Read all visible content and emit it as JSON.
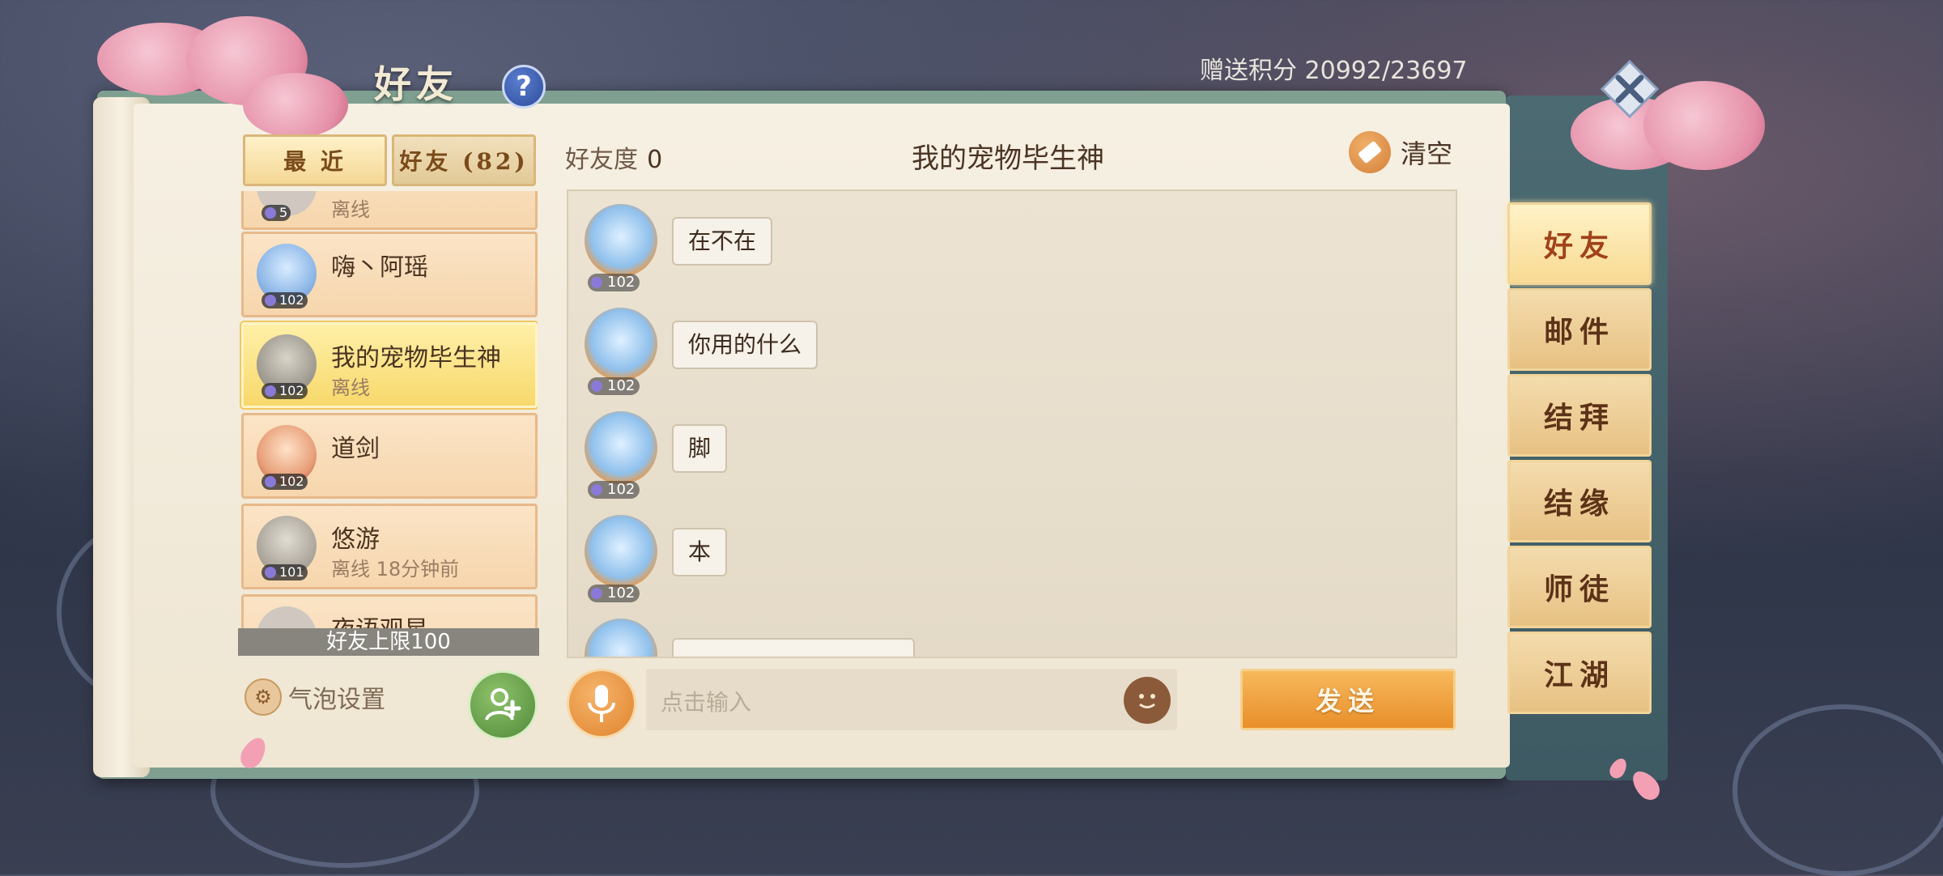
{
  "header": {
    "title": "好友",
    "help_label": "?",
    "points_label": "赠送积分 20992/23697"
  },
  "left_tabs": [
    {
      "label": "最 近",
      "active": true
    },
    {
      "label": "好友 (82)",
      "active": false
    }
  ],
  "friends": [
    {
      "name": "",
      "status": "离线",
      "level": "5"
    },
    {
      "name": "嗨丶阿瑶",
      "status": "",
      "level": "102"
    },
    {
      "name": "我的宠物毕生神",
      "status": "离线",
      "level": "102",
      "selected": true
    },
    {
      "name": "道剑",
      "status": "",
      "level": "102"
    },
    {
      "name": "悠游",
      "status": "离线 18分钟前",
      "level": "101"
    },
    {
      "name": "夜语观星",
      "status": "",
      "level": ""
    }
  ],
  "friend_limit": "好友上限100",
  "bubble_settings_label": "气泡设置",
  "chat": {
    "friendship_label": "好友度",
    "friendship_value": "0",
    "title": "我的宠物毕生神",
    "clear_label": "清空",
    "messages": [
      {
        "text": "在不在",
        "level": "102"
      },
      {
        "text": "你用的什么",
        "level": "102"
      },
      {
        "text": "脚",
        "level": "102"
      },
      {
        "text": "本",
        "level": "102"
      }
    ],
    "input_placeholder": "点击输入",
    "send_label": "发送"
  },
  "side_tabs": [
    {
      "label": "好友",
      "active": true
    },
    {
      "label": "邮件"
    },
    {
      "label": "结拜"
    },
    {
      "label": "结缘"
    },
    {
      "label": "师徒"
    },
    {
      "label": "江湖"
    }
  ],
  "colors": {
    "accent_orange": "#e88f2a",
    "frame_green": "#7fa090",
    "paper": "#f6f0e3"
  }
}
